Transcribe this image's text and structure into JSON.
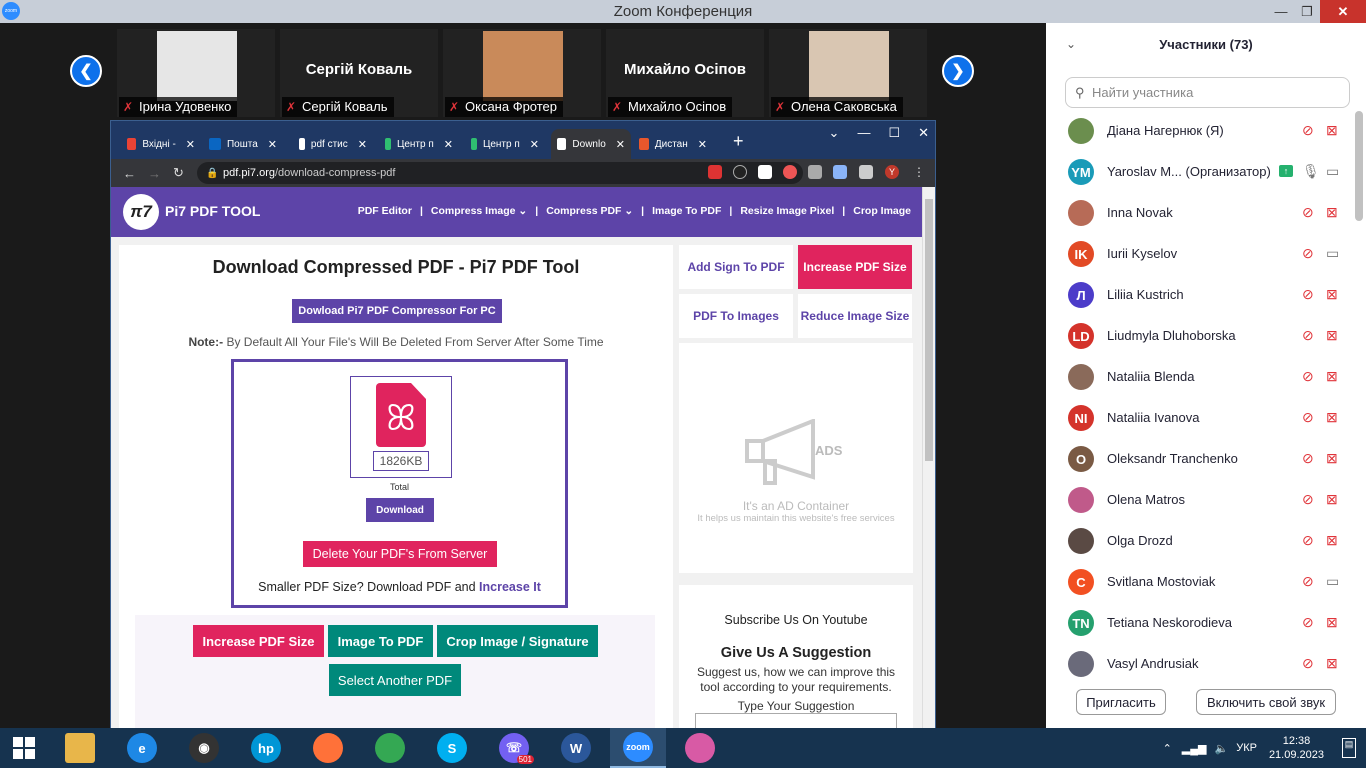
{
  "window": {
    "title": "Zoom Конференция"
  },
  "video": {
    "participants": [
      {
        "name": "Ірина Удовенко",
        "has_photo": true
      },
      {
        "name": "Сергій Коваль",
        "has_photo": false
      },
      {
        "name": "Оксана Фротер",
        "has_photo": true
      },
      {
        "name": "Михайло Осіпов",
        "has_photo": false
      },
      {
        "name": "Олена Саковська",
        "has_photo": true
      }
    ]
  },
  "browser": {
    "tabs": [
      {
        "label": "Вхідні -",
        "icon": "gmail-icon",
        "color": "#ea4335"
      },
      {
        "label": "Пошта",
        "icon": "outlook-icon",
        "color": "#0a66c2"
      },
      {
        "label": "pdf стис",
        "icon": "google-icon",
        "color": "#ffffff"
      },
      {
        "label": "Центр п",
        "icon": "h-icon",
        "color": "#2fbf71"
      },
      {
        "label": "Центр п",
        "icon": "h-icon",
        "color": "#2fbf71"
      },
      {
        "label": "Downlo",
        "icon": "pi7-icon",
        "color": "#ffffff",
        "active": true
      },
      {
        "label": "Дистан",
        "icon": "site-icon",
        "color": "#e8572c"
      }
    ],
    "url_domain": "pdf.pi7.org",
    "url_path": "/download-compress-pdf",
    "profile_initial": "Y"
  },
  "site": {
    "logo": "π7",
    "name": "Pi7 PDF TOOL",
    "nav": [
      "PDF Editor",
      "Compress Image ⌄",
      "Compress PDF ⌄",
      "Image To PDF",
      "Resize Image Pixel",
      "Crop Image"
    ],
    "heading": "Download Compressed PDF - Pi7 PDF Tool",
    "download_pc_btn": "Dowload Pi7 PDF Compressor For PC",
    "note_label": "Note:-",
    "note_text": " By Default All Your File's Will Be Deleted From Server After Some Time",
    "file_size": "1826KB",
    "total_label": "Total",
    "download_btn": "Download",
    "delete_btn": "Delete Your PDF's From Server",
    "smaller_text": "Smaller PDF Size? Download PDF and ",
    "smaller_link": "Increase It",
    "bottom_buttons": [
      {
        "label": "Increase PDF Size",
        "color": "#e0245e"
      },
      {
        "label": "Image To PDF",
        "color": "#00897b"
      },
      {
        "label": "Crop Image / Signature",
        "color": "#00897b"
      },
      {
        "label": "Select Another PDF",
        "color": "#00897b"
      }
    ],
    "side_buttons": [
      {
        "label": "Add Sign To PDF",
        "pink": false
      },
      {
        "label": "Increase PDF Size",
        "pink": true
      },
      {
        "label": "PDF To Images",
        "pink": false
      },
      {
        "label": "Reduce Image Size",
        "pink": false
      }
    ],
    "ad_title": "It's an AD Container",
    "ad_sub": "It helps us maintain this website's free services",
    "ads_label": "ADS",
    "subscribe": "Subscribe Us On Youtube",
    "suggest_title": "Give Us A Suggestion",
    "suggest_text": "Suggest us, how we can improve this tool according to your requirements.",
    "suggest_label": "Type Your Suggestion"
  },
  "panel": {
    "title": "Участники (73)",
    "search_placeholder": "Найти участника",
    "participants": [
      {
        "name": "Діана Нагернюк (Я)",
        "initials": "",
        "color": "#6b8e4e",
        "photo": true,
        "mic": "muted",
        "cam": "off"
      },
      {
        "name": "Yaroslav M...  (Организатор)",
        "initials": "YM",
        "color": "#1a9bb8",
        "photo": false,
        "mic": "on",
        "cam": "on",
        "share": true
      },
      {
        "name": "Inna Novak",
        "initials": "",
        "color": "#b76b57",
        "photo": true,
        "mic": "muted",
        "cam": "off"
      },
      {
        "name": "Iurii Kyselov",
        "initials": "IK",
        "color": "#e24a25",
        "photo": false,
        "mic": "muted",
        "cam": "on"
      },
      {
        "name": "Liliia Kustrich",
        "initials": "Л",
        "color": "#4c3cc9",
        "photo": false,
        "mic": "muted",
        "cam": "off"
      },
      {
        "name": "Liudmyla Dluhoborska",
        "initials": "LD",
        "color": "#d4332b",
        "photo": false,
        "mic": "muted",
        "cam": "off"
      },
      {
        "name": "Nataliia Blenda",
        "initials": "",
        "color": "#8a6a5a",
        "photo": true,
        "mic": "muted",
        "cam": "off"
      },
      {
        "name": "Nataliia Ivanova",
        "initials": "NI",
        "color": "#d4332b",
        "photo": false,
        "mic": "muted",
        "cam": "off"
      },
      {
        "name": "Oleksandr Tranchenko",
        "initials": "O",
        "color": "#7a5a44",
        "photo": false,
        "mic": "muted",
        "cam": "off"
      },
      {
        "name": "Olena Matros",
        "initials": "",
        "color": "#c05a8a",
        "photo": true,
        "mic": "muted",
        "cam": "off"
      },
      {
        "name": "Olga Drozd",
        "initials": "",
        "color": "#5a4a44",
        "photo": true,
        "mic": "muted",
        "cam": "off"
      },
      {
        "name": "Svitlana Mostoviak",
        "initials": "C",
        "color": "#f25022",
        "photo": false,
        "mic": "muted",
        "cam": "on"
      },
      {
        "name": "Tetiana Neskorodieva",
        "initials": "TN",
        "color": "#25a06e",
        "photo": false,
        "mic": "muted",
        "cam": "off"
      },
      {
        "name": "Vasyl Andrusiak",
        "initials": "",
        "color": "#6a6a7a",
        "photo": true,
        "mic": "muted",
        "cam": "off"
      }
    ],
    "invite_btn": "Пригласить",
    "unmute_btn": "Включить свой звук"
  },
  "taskbar": {
    "apps": [
      {
        "name": "file-explorer-icon",
        "color": "#e8b64a",
        "label": ""
      },
      {
        "name": "ie-icon",
        "color": "#1e88e5",
        "label": "e"
      },
      {
        "name": "webcam-icon",
        "color": "#333333",
        "label": "◉"
      },
      {
        "name": "hp-icon",
        "color": "#0096d6",
        "label": "hp"
      },
      {
        "name": "firefox-icon",
        "color": "#ff7139",
        "label": ""
      },
      {
        "name": "chrome-icon",
        "color": "#34a853",
        "label": ""
      },
      {
        "name": "skype-icon",
        "color": "#00aff0",
        "label": "S"
      },
      {
        "name": "viber-icon",
        "color": "#7360f2",
        "label": "☏",
        "badge": "501"
      },
      {
        "name": "word-icon",
        "color": "#2b579a",
        "label": "W"
      },
      {
        "name": "zoom-icon",
        "color": "#2d8cff",
        "label": "zoom",
        "active": true
      },
      {
        "name": "paint-icon",
        "color": "#d85aa5",
        "label": ""
      }
    ],
    "lang": "УКР",
    "time": "12:38",
    "date": "21.09.2023"
  }
}
